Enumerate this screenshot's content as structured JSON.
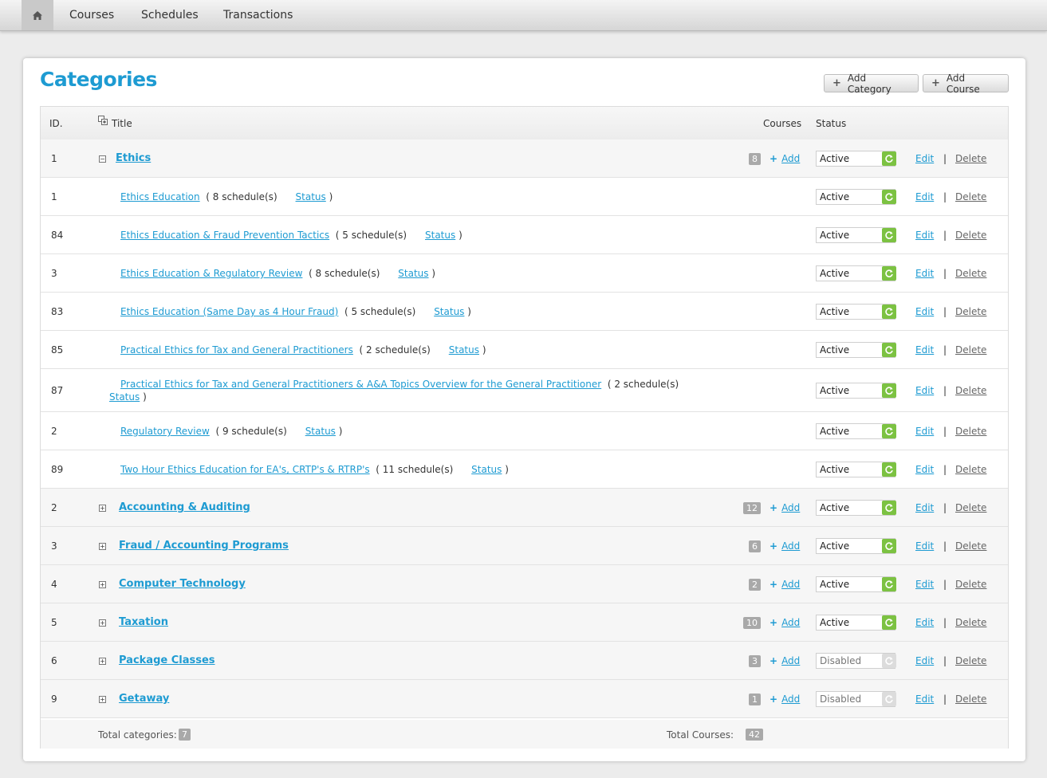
{
  "nav": {
    "items": [
      "Courses",
      "Schedules",
      "Transactions"
    ]
  },
  "page": {
    "title": "Categories"
  },
  "buttons": {
    "add_category": "Add Category",
    "add_course": "Add Course"
  },
  "table": {
    "headers": {
      "id": "ID.",
      "title": "Title",
      "courses": "Courses",
      "status": "Status"
    },
    "rows": [
      {
        "kind": "category",
        "id": "1",
        "expanded": true,
        "title": "Ethics",
        "count": "8",
        "add": "Add",
        "status": "Active",
        "enabled": true,
        "edit": "Edit",
        "delete": "Delete"
      },
      {
        "kind": "course",
        "id": "1",
        "title": "Ethics Education",
        "schedules": "( 8 schedule(s)",
        "status_link": "Status",
        "close": ")",
        "status": "Active",
        "enabled": true,
        "edit": "Edit",
        "delete": "Delete"
      },
      {
        "kind": "course",
        "id": "84",
        "title": "Ethics Education & Fraud Prevention Tactics",
        "schedules": "( 5 schedule(s)",
        "status_link": "Status",
        "close": ")",
        "status": "Active",
        "enabled": true,
        "edit": "Edit",
        "delete": "Delete"
      },
      {
        "kind": "course",
        "id": "3",
        "title": "Ethics Education & Regulatory Review",
        "schedules": "( 8 schedule(s)",
        "status_link": "Status",
        "close": ")",
        "status": "Active",
        "enabled": true,
        "edit": "Edit",
        "delete": "Delete"
      },
      {
        "kind": "course",
        "id": "83",
        "title": "Ethics Education (Same Day as 4 Hour Fraud)",
        "schedules": "( 5 schedule(s)",
        "status_link": "Status",
        "close": ")",
        "status": "Active",
        "enabled": true,
        "edit": "Edit",
        "delete": "Delete"
      },
      {
        "kind": "course",
        "id": "85",
        "title": "Practical Ethics for Tax and General Practitioners",
        "schedules": "( 2 schedule(s)",
        "status_link": "Status",
        "close": ")",
        "status": "Active",
        "enabled": true,
        "edit": "Edit",
        "delete": "Delete"
      },
      {
        "kind": "course",
        "id": "87",
        "title": "Practical Ethics for Tax and General Practitioners & A&A Topics Overview for the General Practitioner",
        "schedules": "( 2 schedule(s)",
        "status_link": "Status",
        "close": ")",
        "wrapped": true,
        "status": "Active",
        "enabled": true,
        "edit": "Edit",
        "delete": "Delete"
      },
      {
        "kind": "course",
        "id": "2",
        "title": "Regulatory Review",
        "schedules": "( 9 schedule(s)",
        "status_link": "Status",
        "close": ")",
        "status": "Active",
        "enabled": true,
        "edit": "Edit",
        "delete": "Delete"
      },
      {
        "kind": "course",
        "id": "89",
        "title": "Two Hour Ethics Education for EA's, CRTP's & RTRP's",
        "schedules": "( 11 schedule(s)",
        "status_link": "Status",
        "close": ")",
        "status": "Active",
        "enabled": true,
        "edit": "Edit",
        "delete": "Delete"
      },
      {
        "kind": "category",
        "id": "2",
        "expanded": false,
        "title": "Accounting & Auditing",
        "count": "12",
        "add": "Add",
        "status": "Active",
        "enabled": true,
        "edit": "Edit",
        "delete": "Delete"
      },
      {
        "kind": "category",
        "id": "3",
        "expanded": false,
        "title": "Fraud / Accounting Programs",
        "count": "6",
        "add": "Add",
        "status": "Active",
        "enabled": true,
        "edit": "Edit",
        "delete": "Delete"
      },
      {
        "kind": "category",
        "id": "4",
        "expanded": false,
        "title": "Computer Technology",
        "count": "2",
        "add": "Add",
        "status": "Active",
        "enabled": true,
        "edit": "Edit",
        "delete": "Delete"
      },
      {
        "kind": "category",
        "id": "5",
        "expanded": false,
        "title": "Taxation",
        "count": "10",
        "add": "Add",
        "status": "Active",
        "enabled": true,
        "edit": "Edit",
        "delete": "Delete"
      },
      {
        "kind": "category",
        "id": "6",
        "expanded": false,
        "title": "Package Classes",
        "count": "3",
        "add": "Add",
        "status": "Disabled",
        "enabled": false,
        "edit": "Edit",
        "delete": "Delete"
      },
      {
        "kind": "category",
        "id": "9",
        "expanded": false,
        "title": "Getaway",
        "count": "1",
        "add": "Add",
        "status": "Disabled",
        "enabled": false,
        "edit": "Edit",
        "delete": "Delete"
      }
    ],
    "separator": "|"
  },
  "footer": {
    "total_categories_label": "Total categories:",
    "total_categories": "7",
    "total_courses_label": "Total Courses:",
    "total_courses": "42"
  },
  "colors": {
    "accent": "#1e9bd2",
    "active_toggle": "#7cc242",
    "disabled_toggle": "#dcdcdc"
  },
  "icons": {
    "home": "home-icon",
    "expand": "expand-icon",
    "collapse": "collapse-icon",
    "refresh": "refresh-icon",
    "tree": "tree-icon",
    "plus": "plus-icon"
  }
}
